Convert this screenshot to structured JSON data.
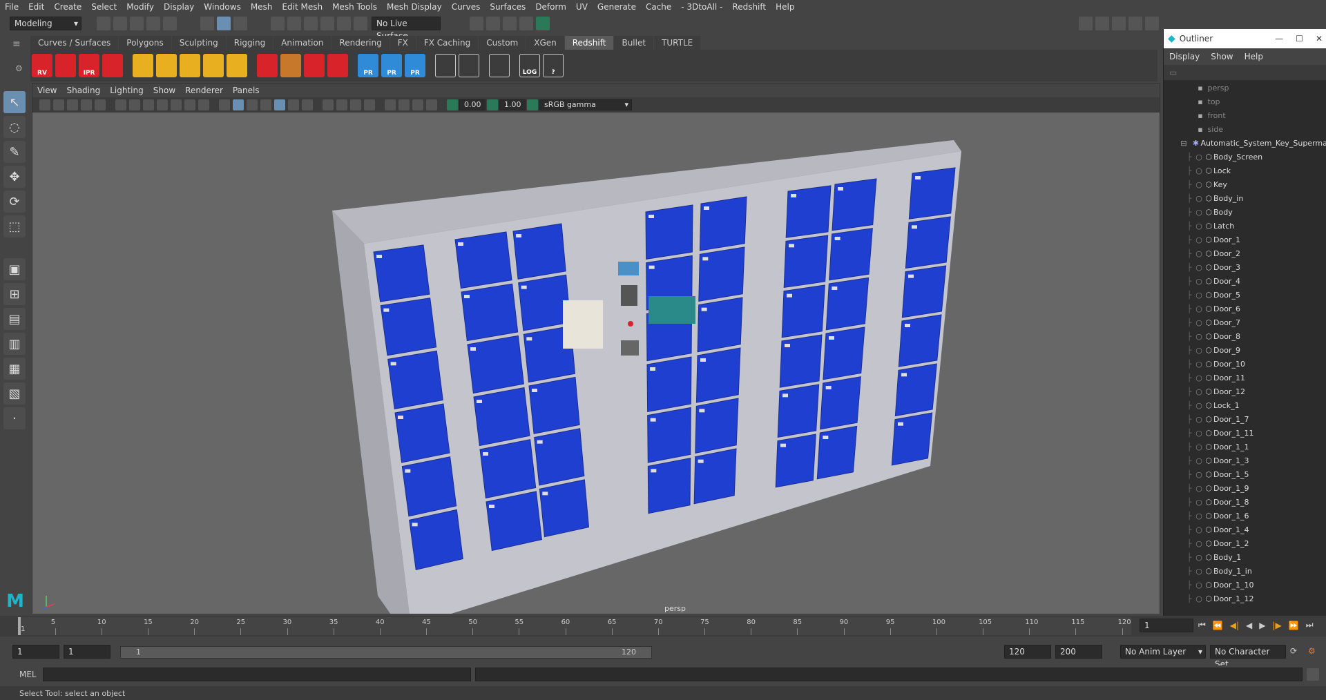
{
  "menubar": {
    "items": [
      "File",
      "Edit",
      "Create",
      "Select",
      "Modify",
      "Display",
      "Windows",
      "Mesh",
      "Edit Mesh",
      "Mesh Tools",
      "Mesh Display",
      "Curves",
      "Surfaces",
      "Deform",
      "UV",
      "Generate",
      "Cache",
      "- 3DtoAll -",
      "Redshift",
      "Help"
    ]
  },
  "statusline": {
    "mode": "Modeling",
    "live_surface": "No Live Surface"
  },
  "shelf": {
    "tabs": [
      "Curves / Surfaces",
      "Polygons",
      "Sculpting",
      "Rigging",
      "Animation",
      "Rendering",
      "FX",
      "FX Caching",
      "Custom",
      "XGen",
      "Redshift",
      "Bullet",
      "TURTLE"
    ],
    "active_tab": "Redshift",
    "icons": [
      {
        "name": "rv-icon",
        "label": "RV",
        "color": "#d8232a"
      },
      {
        "name": "render-cube-icon",
        "label": "",
        "color": "#d8232a"
      },
      {
        "name": "ipr-icon",
        "label": "IPR",
        "color": "#d8232a"
      },
      {
        "name": "render-settings-icon",
        "label": "",
        "color": "#d8232a"
      },
      {
        "name": "grid-diamond-icon",
        "label": "",
        "color": "#e8b020"
      },
      {
        "name": "grid-squares-icon",
        "label": "",
        "color": "#e8b020"
      },
      {
        "name": "cone-light-icon",
        "label": "",
        "color": "#e8b020"
      },
      {
        "name": "dome-light-icon",
        "label": "",
        "color": "#e8b020"
      },
      {
        "name": "sun-light-icon",
        "label": "",
        "color": "#e8b020"
      },
      {
        "name": "proxy-cube-icon",
        "label": "",
        "color": "#d8232a"
      },
      {
        "name": "hair-icon",
        "label": "",
        "color": "#c8782a"
      },
      {
        "name": "volume-icon",
        "label": "",
        "color": "#d8232a"
      },
      {
        "name": "sphere-material-icon",
        "label": "",
        "color": "#d8232a"
      },
      {
        "name": "pr-cube-icon",
        "label": "PR",
        "color": "#2f8ad8"
      },
      {
        "name": "pr-arrow-icon",
        "label": "PR",
        "color": "#2f8ad8"
      },
      {
        "name": "pr-swap-icon",
        "label": "PR",
        "color": "#2f8ad8"
      },
      {
        "name": "bowl-icon",
        "label": "",
        "color": "#cccccc"
      },
      {
        "name": "bowl-2-icon",
        "label": "",
        "color": "#cccccc"
      },
      {
        "name": "code-icon",
        "label": "",
        "color": "#cccccc"
      },
      {
        "name": "log-icon",
        "label": "LOG",
        "color": "#cccccc"
      },
      {
        "name": "help-icon",
        "label": "?",
        "color": "#cccccc"
      }
    ]
  },
  "panel": {
    "menu": [
      "View",
      "Shading",
      "Lighting",
      "Show",
      "Renderer",
      "Panels"
    ],
    "exposure": "0.00",
    "gamma": "1.00",
    "color_space": "sRGB gamma",
    "view_label": "persp"
  },
  "scene": {
    "locker_color": "#1f3fd0",
    "body_color": "#c4c4cc"
  },
  "outliner": {
    "title": "Outliner",
    "menu": [
      "Display",
      "Show",
      "Help"
    ],
    "cameras": [
      "persp",
      "top",
      "front",
      "side"
    ],
    "group": "Automatic_System_Key_Supermarket",
    "items": [
      "Body_Screen",
      "Lock",
      "Key",
      "Body_in",
      "Body",
      "Latch",
      "Door_1",
      "Door_2",
      "Door_3",
      "Door_4",
      "Door_5",
      "Door_6",
      "Door_7",
      "Door_8",
      "Door_9",
      "Door_10",
      "Door_11",
      "Door_12",
      "Lock_1",
      "Door_1_7",
      "Door_1_11",
      "Door_1_1",
      "Door_1_3",
      "Door_1_5",
      "Door_1_9",
      "Door_1_8",
      "Door_1_6",
      "Door_1_4",
      "Door_1_2",
      "Body_1",
      "Body_1_in",
      "Door_1_10",
      "Door_1_12"
    ]
  },
  "timeline": {
    "ticks": [
      "5",
      "10",
      "15",
      "20",
      "25",
      "30",
      "35",
      "40",
      "45",
      "50",
      "55",
      "60",
      "65",
      "70",
      "75",
      "80",
      "85",
      "90",
      "95",
      "100",
      "105",
      "110",
      "115",
      "120"
    ],
    "current_frame": "1",
    "start_frame": "1",
    "range_start": "1",
    "range_slider_start": "1",
    "range_slider_end": "120",
    "playback_end": "120",
    "anim_end": "200",
    "anim_layer": "No Anim Layer",
    "character_set": "No Character Set"
  },
  "commandline": {
    "label": "MEL"
  },
  "helpline": {
    "text": "Select Tool: select an object"
  }
}
